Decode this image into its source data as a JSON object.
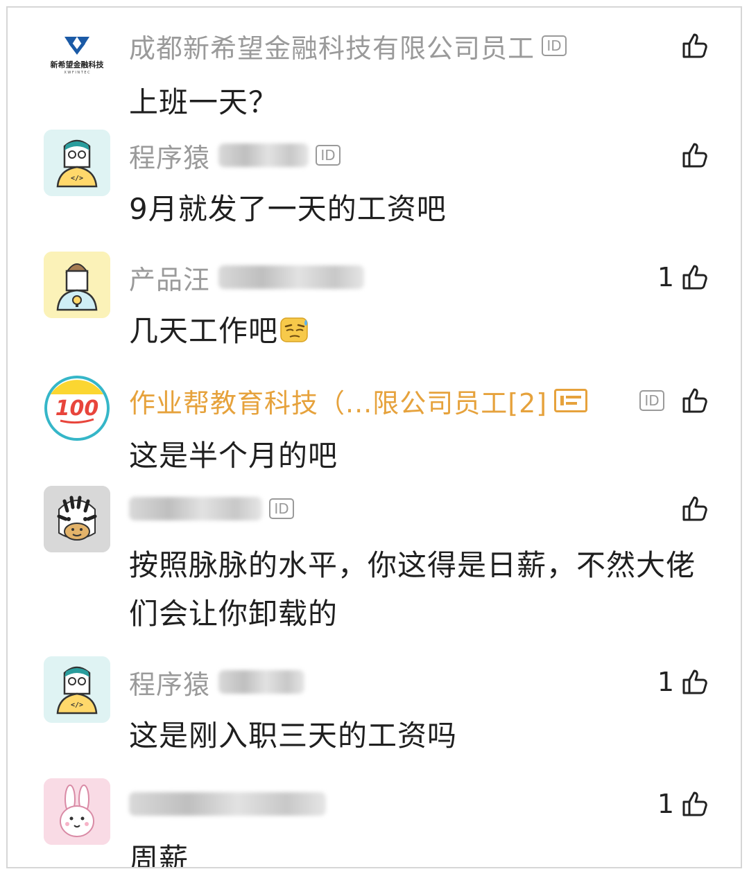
{
  "comments": [
    {
      "name": "成都新希望金融科技有限公司员工",
      "company_logo_text": "新希望金融科技",
      "company_logo_sub": "X W F I N T E C",
      "likes": "",
      "text": "上班一天？"
    },
    {
      "name": "程序猿",
      "likes": "",
      "text": "9月就发了一天的工资吧"
    },
    {
      "name": "产品汪",
      "likes": "1",
      "text": "几天工作吧"
    },
    {
      "name": "作业帮教育科技（...限公司员工[2]",
      "avatar_text": "100",
      "likes": "",
      "text": "这是半个月的吧"
    },
    {
      "name": "",
      "likes": "",
      "text": "按照脉脉的水平，你这得是日薪，不然大佬们会让你卸载的"
    },
    {
      "name": "程序猿",
      "likes": "1",
      "text": "这是刚入职三天的工资吗"
    },
    {
      "name": "",
      "likes": "1",
      "text": "周薪"
    }
  ],
  "badges": {
    "id_label": "ID"
  },
  "icons": {
    "like": "thumbs-up-icon",
    "verified": "id-card-icon",
    "emoji": "sweat-emoji-icon"
  },
  "colors": {
    "name_gray": "#9a9a9a",
    "company_gold": "#e6a23c",
    "text": "#1f1f1f"
  }
}
